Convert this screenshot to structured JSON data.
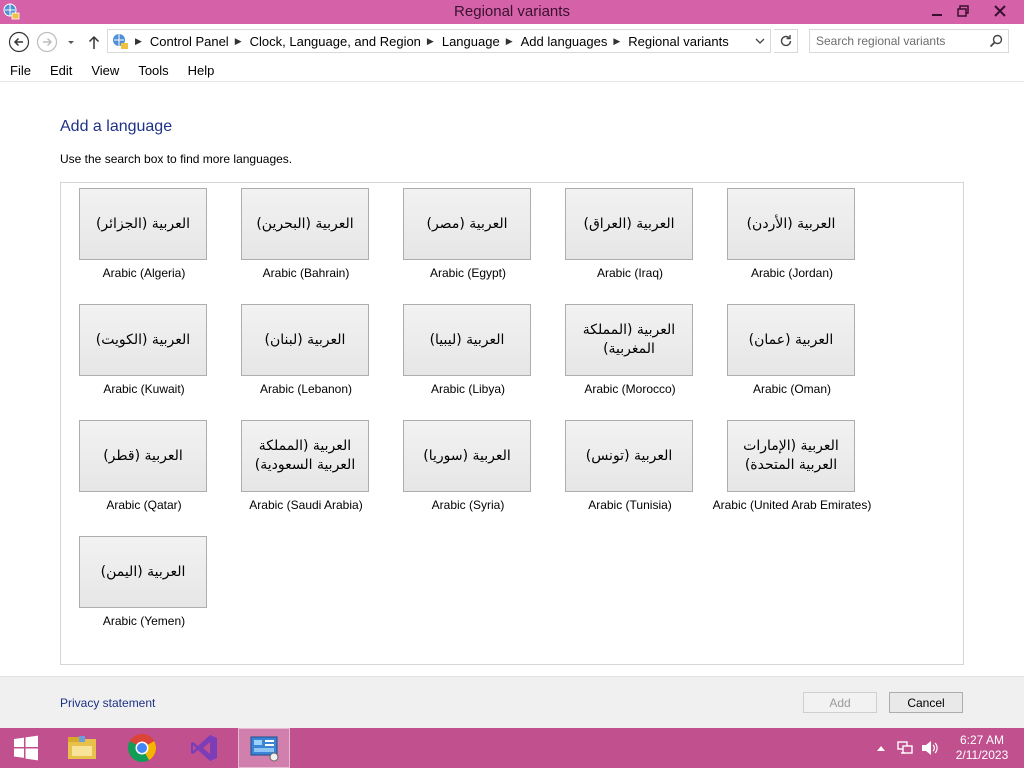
{
  "window": {
    "title": "Regional variants"
  },
  "nav": {
    "breadcrumbs": [
      "Control Panel",
      "Clock, Language, and Region",
      "Language",
      "Add languages",
      "Regional variants"
    ]
  },
  "search": {
    "placeholder": "Search regional variants"
  },
  "menu": {
    "items": [
      "File",
      "Edit",
      "View",
      "Tools",
      "Help"
    ]
  },
  "content": {
    "heading": "Add a language",
    "hint": "Use the search box to find more languages."
  },
  "languages": [
    {
      "native": "العربية (الجزائر)",
      "label": "Arabic (Algeria)"
    },
    {
      "native": "العربية (البحرين)",
      "label": "Arabic (Bahrain)"
    },
    {
      "native": "العربية (مصر)",
      "label": "Arabic (Egypt)"
    },
    {
      "native": "العربية (العراق)",
      "label": "Arabic (Iraq)"
    },
    {
      "native": "العربية (الأردن)",
      "label": "Arabic (Jordan)"
    },
    {
      "native": "العربية (الكويت)",
      "label": "Arabic (Kuwait)"
    },
    {
      "native": "العربية (لبنان)",
      "label": "Arabic (Lebanon)"
    },
    {
      "native": "العربية (ليبيا)",
      "label": "Arabic (Libya)"
    },
    {
      "native": "العربية (المملكة المغربية)",
      "label": "Arabic (Morocco)"
    },
    {
      "native": "العربية (عمان)",
      "label": "Arabic (Oman)"
    },
    {
      "native": "العربية (قطر)",
      "label": "Arabic (Qatar)"
    },
    {
      "native": "العربية (المملكة العربية السعودية)",
      "label": "Arabic (Saudi Arabia)"
    },
    {
      "native": "العربية (سوريا)",
      "label": "Arabic (Syria)"
    },
    {
      "native": "العربية (تونس)",
      "label": "Arabic (Tunisia)"
    },
    {
      "native": "العربية (الإمارات العربية المتحدة)",
      "label": "Arabic (United Arab Emirates)"
    },
    {
      "native": "العربية (اليمن)",
      "label": "Arabic (Yemen)"
    }
  ],
  "footer": {
    "privacy_label": "Privacy statement",
    "add_label": "Add",
    "add_enabled": false,
    "cancel_label": "Cancel"
  },
  "taskbar": {
    "apps": [
      "start-icon",
      "file-explorer-icon",
      "chrome-icon",
      "visual-studio-icon",
      "control-panel-icon"
    ],
    "active_app": "control-panel-icon",
    "time": "6:27 AM",
    "date": "2/11/2023"
  },
  "colors": {
    "titlebar": "#d562a8",
    "taskbar": "#c0508e",
    "link": "#1e3287"
  }
}
